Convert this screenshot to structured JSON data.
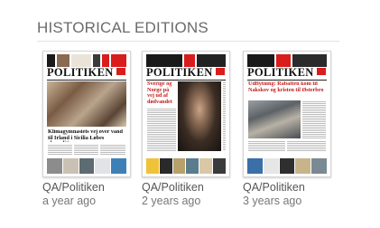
{
  "section": {
    "title": "HISTORICAL EDITIONS"
  },
  "editions": [
    {
      "title": "QA/Politiken",
      "date": "a year ago",
      "masthead": "POLITIKEN",
      "headline": "Klimagymnasiets vej over vand til Irland i Sicilia Løbes ekspeditionen"
    },
    {
      "title": "QA/Politiken",
      "date": "2 years ago",
      "masthead": "POLITIKEN",
      "headline": "Sverige og Norge på vej ud af dødvandet"
    },
    {
      "title": "QA/Politiken",
      "date": "3 years ago",
      "masthead": "POLITIKEN",
      "headline": "Udflytning: Rabatten kom til Nakskov og kristen til Østerbro"
    }
  ],
  "colors": {
    "accent": "#d91d1d",
    "title": "#6b6b6b",
    "text": "#555555"
  }
}
